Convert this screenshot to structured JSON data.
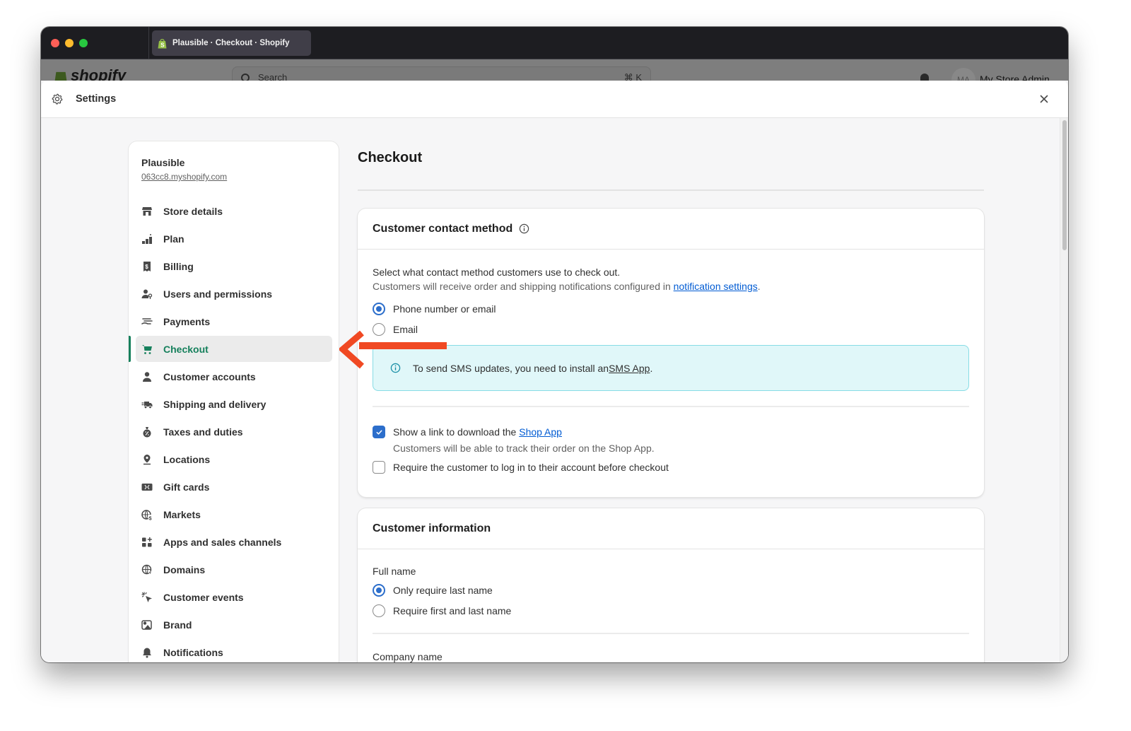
{
  "browser": {
    "tab_title": "Plausible · Checkout · Shopify"
  },
  "background_app": {
    "logo_text": "shopify",
    "search_placeholder": "Search",
    "search_shortcut": "⌘ K",
    "avatar_initials": "MA",
    "user_name": "My Store Admin"
  },
  "modal": {
    "title": "Settings",
    "icon": "gear-icon",
    "close_icon": "close-icon"
  },
  "sidebar": {
    "store_name": "Plausible",
    "store_url": "063cc8.myshopify.com",
    "active_item": "Checkout",
    "accent_color": "#16805c",
    "items": [
      {
        "label": "Store details",
        "icon": "store-icon"
      },
      {
        "label": "Plan",
        "icon": "plan-icon"
      },
      {
        "label": "Billing",
        "icon": "billing-receipt-icon"
      },
      {
        "label": "Users and permissions",
        "icon": "users-permissions-icon"
      },
      {
        "label": "Payments",
        "icon": "payments-hand-icon"
      },
      {
        "label": "Checkout",
        "icon": "cart-icon"
      },
      {
        "label": "Customer accounts",
        "icon": "person-icon"
      },
      {
        "label": "Shipping and delivery",
        "icon": "truck-icon"
      },
      {
        "label": "Taxes and duties",
        "icon": "tax-bag-icon"
      },
      {
        "label": "Locations",
        "icon": "location-pin-icon"
      },
      {
        "label": "Gift cards",
        "icon": "gift-card-icon"
      },
      {
        "label": "Markets",
        "icon": "globe-dollar-icon"
      },
      {
        "label": "Apps and sales channels",
        "icon": "apps-icon"
      },
      {
        "label": "Domains",
        "icon": "globe-cursor-icon"
      },
      {
        "label": "Customer events",
        "icon": "cursor-click-icon"
      },
      {
        "label": "Brand",
        "icon": "brand-image-icon"
      },
      {
        "label": "Notifications",
        "icon": "bell-icon"
      }
    ]
  },
  "main": {
    "page_title": "Checkout",
    "contact_card": {
      "title": "Customer contact method",
      "intro": "Select what contact method customers use to check out.",
      "notice_prefix": "Customers will receive order and shipping notifications configured in ",
      "notice_link": "notification settings",
      "notice_suffix": ".",
      "options": [
        {
          "label": "Phone number or email",
          "selected": true
        },
        {
          "label": "Email",
          "selected": false
        }
      ],
      "banner": {
        "text_prefix": "To send SMS updates, you need to install an ",
        "link": "SMS App",
        "text_suffix": ".",
        "bg_color": "#e0f7f9"
      },
      "checkboxes": [
        {
          "label_prefix": "Show a link to download the ",
          "link": "Shop App",
          "checked": true,
          "helper": "Customers will be able to track their order on the Shop App."
        },
        {
          "label": "Require the customer to log in to their account before checkout",
          "checked": false
        }
      ]
    },
    "info_card": {
      "title": "Customer information",
      "full_name_label": "Full name",
      "options": [
        {
          "label": "Only require last name",
          "selected": true
        },
        {
          "label": "Require first and last name",
          "selected": false
        }
      ],
      "company_label": "Company name"
    }
  },
  "annotation": {
    "arrow_color": "#f04923",
    "points_to": "Checkout"
  }
}
